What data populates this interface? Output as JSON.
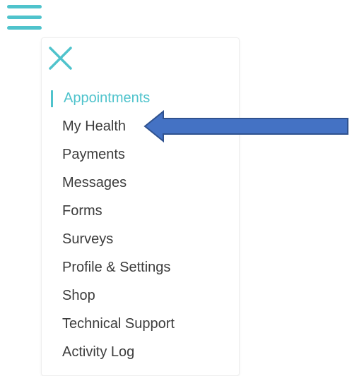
{
  "colors": {
    "accent": "#4fc3cc",
    "text": "#3c3c3c",
    "arrow_fill": "#4472c4",
    "arrow_stroke": "#2f528f"
  },
  "header": {
    "menu_icon": "hamburger-menu-icon"
  },
  "menu": {
    "close_icon": "close-icon",
    "active_item": "Appointments",
    "items": [
      {
        "label": "Appointments"
      },
      {
        "label": "My Health"
      },
      {
        "label": "Payments"
      },
      {
        "label": "Messages"
      },
      {
        "label": "Forms"
      },
      {
        "label": "Surveys"
      },
      {
        "label": "Profile & Settings"
      },
      {
        "label": "Shop"
      },
      {
        "label": "Technical Support"
      },
      {
        "label": "Activity Log"
      }
    ]
  },
  "annotation": {
    "arrow_icon": "left-arrow-icon",
    "points_to": "My Health"
  }
}
